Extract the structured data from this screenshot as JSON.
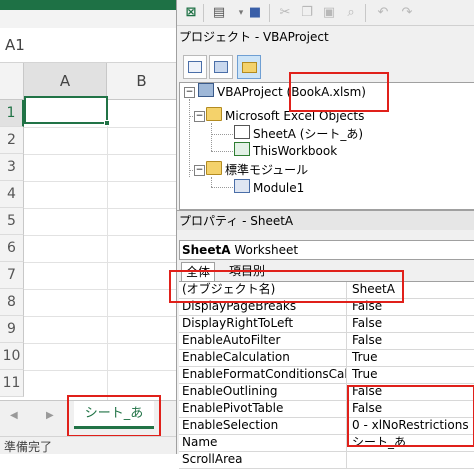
{
  "excel": {
    "name_box": "A1",
    "columns": [
      "A",
      "B"
    ],
    "rows": [
      "1",
      "2",
      "3",
      "4",
      "5",
      "6",
      "7",
      "8",
      "9",
      "10",
      "11"
    ],
    "sheet_tab": "シート_あ",
    "status": "準備完了",
    "tab_nav_prev": "◀",
    "tab_nav_next": "▶",
    "accent": "#217346"
  },
  "vbe": {
    "toolbar_icons": [
      "excel-icon",
      "insert-userform-icon",
      "save-icon",
      "cut-icon",
      "copy-icon",
      "paste-icon",
      "find-icon",
      "undo-icon",
      "redo-icon"
    ],
    "project_title": "プロジェクト - VBAProject",
    "project_toolbar": [
      "view-code-icon",
      "view-object-icon",
      "toggle-folders-icon"
    ],
    "tree": {
      "project": "VBAProject (BookA.xlsm)",
      "excel_objects_folder": "Microsoft Excel Objects",
      "sheet": "SheetA (シート_あ)",
      "workbook": "ThisWorkbook",
      "modules_folder": "標準モジュール",
      "module": "Module1"
    },
    "properties_title": "プロパティ - SheetA",
    "object_box": {
      "name": "SheetA",
      "type": "Worksheet"
    },
    "tabs": [
      "全体",
      "項目別"
    ],
    "properties": [
      {
        "name": "(オブジェクト名)",
        "value": "SheetA"
      },
      {
        "name": "DisplayPageBreaks",
        "value": "False"
      },
      {
        "name": "DisplayRightToLeft",
        "value": "False"
      },
      {
        "name": "EnableAutoFilter",
        "value": "False"
      },
      {
        "name": "EnableCalculation",
        "value": "True"
      },
      {
        "name": "EnableFormatConditionsCalc",
        "value": "True"
      },
      {
        "name": "EnableOutlining",
        "value": "False"
      },
      {
        "name": "EnablePivotTable",
        "value": "False"
      },
      {
        "name": "EnableSelection",
        "value": "0 - xlNoRestrictions"
      },
      {
        "name": "Name",
        "value": "シート_あ"
      },
      {
        "name": "ScrollArea",
        "value": ""
      }
    ],
    "highlight_color": "#e0201a"
  }
}
